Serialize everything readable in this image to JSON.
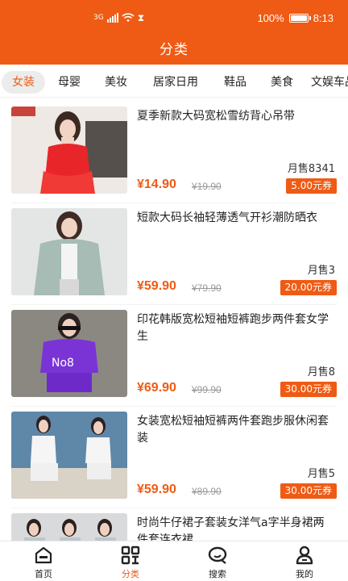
{
  "status_bar": {
    "network_label": "3G",
    "battery_percent": "100%",
    "battery_level": 1.0,
    "time": "8:13",
    "icons": [
      "signal-icon",
      "wifi-icon",
      "hourglass-icon",
      "battery-icon"
    ]
  },
  "header": {
    "title": "分类"
  },
  "tabs": [
    {
      "label": "女装",
      "active": true
    },
    {
      "label": "母婴"
    },
    {
      "label": "美妆"
    },
    {
      "label": "居家日用"
    },
    {
      "label": "鞋品"
    },
    {
      "label": "美食"
    },
    {
      "label": "文娱车品"
    }
  ],
  "products": [
    {
      "title": "夏季新款大码宽松雪纺背心吊带",
      "sales": "月售8341",
      "price": "¥14.90",
      "original_price": "¥19.90",
      "coupon": "5.00元券"
    },
    {
      "title": "短款大码长袖轻薄透气开衫潮防晒衣",
      "sales": "月售3",
      "price": "¥59.90",
      "original_price": "¥79.90",
      "coupon": "20.00元券"
    },
    {
      "title": "印花韩版宽松短袖短裤跑步两件套女学生",
      "sales": "月售8",
      "price": "¥69.90",
      "original_price": "¥99.90",
      "coupon": "30.00元券"
    },
    {
      "title": "女装宽松短袖短裤两件套跑步服休闲套装",
      "sales": "月售5",
      "price": "¥59.90",
      "original_price": "¥89.90",
      "coupon": "30.00元券"
    },
    {
      "title": "时尚牛仔裙子套装女洋气a字半身裙两件套连衣裙",
      "sales": "",
      "price": "",
      "original_price": "",
      "coupon": ""
    }
  ],
  "bottom_nav": [
    {
      "label": "首页",
      "icon": "home-icon"
    },
    {
      "label": "分类",
      "icon": "category-icon",
      "active": true
    },
    {
      "label": "搜索",
      "icon": "search-icon"
    },
    {
      "label": "我的",
      "icon": "user-icon"
    }
  ],
  "colors": {
    "accent": "#ef5b14",
    "tab_active_bg": "#ececec"
  }
}
